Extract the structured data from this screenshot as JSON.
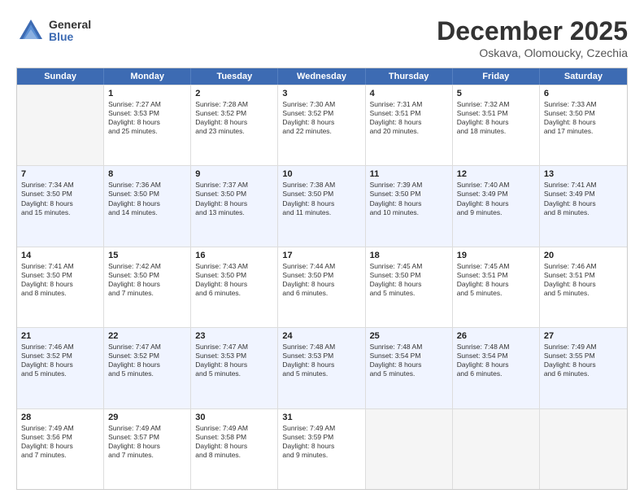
{
  "header": {
    "logo_line1": "General",
    "logo_line2": "Blue",
    "month": "December 2025",
    "location": "Oskava, Olomoucky, Czechia"
  },
  "days": [
    "Sunday",
    "Monday",
    "Tuesday",
    "Wednesday",
    "Thursday",
    "Friday",
    "Saturday"
  ],
  "rows": [
    [
      {
        "day": "",
        "lines": [],
        "empty": true
      },
      {
        "day": "1",
        "lines": [
          "Sunrise: 7:27 AM",
          "Sunset: 3:53 PM",
          "Daylight: 8 hours",
          "and 25 minutes."
        ]
      },
      {
        "day": "2",
        "lines": [
          "Sunrise: 7:28 AM",
          "Sunset: 3:52 PM",
          "Daylight: 8 hours",
          "and 23 minutes."
        ]
      },
      {
        "day": "3",
        "lines": [
          "Sunrise: 7:30 AM",
          "Sunset: 3:52 PM",
          "Daylight: 8 hours",
          "and 22 minutes."
        ]
      },
      {
        "day": "4",
        "lines": [
          "Sunrise: 7:31 AM",
          "Sunset: 3:51 PM",
          "Daylight: 8 hours",
          "and 20 minutes."
        ]
      },
      {
        "day": "5",
        "lines": [
          "Sunrise: 7:32 AM",
          "Sunset: 3:51 PM",
          "Daylight: 8 hours",
          "and 18 minutes."
        ]
      },
      {
        "day": "6",
        "lines": [
          "Sunrise: 7:33 AM",
          "Sunset: 3:50 PM",
          "Daylight: 8 hours",
          "and 17 minutes."
        ]
      }
    ],
    [
      {
        "day": "7",
        "lines": [
          "Sunrise: 7:34 AM",
          "Sunset: 3:50 PM",
          "Daylight: 8 hours",
          "and 15 minutes."
        ]
      },
      {
        "day": "8",
        "lines": [
          "Sunrise: 7:36 AM",
          "Sunset: 3:50 PM",
          "Daylight: 8 hours",
          "and 14 minutes."
        ]
      },
      {
        "day": "9",
        "lines": [
          "Sunrise: 7:37 AM",
          "Sunset: 3:50 PM",
          "Daylight: 8 hours",
          "and 13 minutes."
        ]
      },
      {
        "day": "10",
        "lines": [
          "Sunrise: 7:38 AM",
          "Sunset: 3:50 PM",
          "Daylight: 8 hours",
          "and 11 minutes."
        ]
      },
      {
        "day": "11",
        "lines": [
          "Sunrise: 7:39 AM",
          "Sunset: 3:50 PM",
          "Daylight: 8 hours",
          "and 10 minutes."
        ]
      },
      {
        "day": "12",
        "lines": [
          "Sunrise: 7:40 AM",
          "Sunset: 3:49 PM",
          "Daylight: 8 hours",
          "and 9 minutes."
        ]
      },
      {
        "day": "13",
        "lines": [
          "Sunrise: 7:41 AM",
          "Sunset: 3:49 PM",
          "Daylight: 8 hours",
          "and 8 minutes."
        ]
      }
    ],
    [
      {
        "day": "14",
        "lines": [
          "Sunrise: 7:41 AM",
          "Sunset: 3:50 PM",
          "Daylight: 8 hours",
          "and 8 minutes."
        ]
      },
      {
        "day": "15",
        "lines": [
          "Sunrise: 7:42 AM",
          "Sunset: 3:50 PM",
          "Daylight: 8 hours",
          "and 7 minutes."
        ]
      },
      {
        "day": "16",
        "lines": [
          "Sunrise: 7:43 AM",
          "Sunset: 3:50 PM",
          "Daylight: 8 hours",
          "and 6 minutes."
        ]
      },
      {
        "day": "17",
        "lines": [
          "Sunrise: 7:44 AM",
          "Sunset: 3:50 PM",
          "Daylight: 8 hours",
          "and 6 minutes."
        ]
      },
      {
        "day": "18",
        "lines": [
          "Sunrise: 7:45 AM",
          "Sunset: 3:50 PM",
          "Daylight: 8 hours",
          "and 5 minutes."
        ]
      },
      {
        "day": "19",
        "lines": [
          "Sunrise: 7:45 AM",
          "Sunset: 3:51 PM",
          "Daylight: 8 hours",
          "and 5 minutes."
        ]
      },
      {
        "day": "20",
        "lines": [
          "Sunrise: 7:46 AM",
          "Sunset: 3:51 PM",
          "Daylight: 8 hours",
          "and 5 minutes."
        ]
      }
    ],
    [
      {
        "day": "21",
        "lines": [
          "Sunrise: 7:46 AM",
          "Sunset: 3:52 PM",
          "Daylight: 8 hours",
          "and 5 minutes."
        ]
      },
      {
        "day": "22",
        "lines": [
          "Sunrise: 7:47 AM",
          "Sunset: 3:52 PM",
          "Daylight: 8 hours",
          "and 5 minutes."
        ]
      },
      {
        "day": "23",
        "lines": [
          "Sunrise: 7:47 AM",
          "Sunset: 3:53 PM",
          "Daylight: 8 hours",
          "and 5 minutes."
        ]
      },
      {
        "day": "24",
        "lines": [
          "Sunrise: 7:48 AM",
          "Sunset: 3:53 PM",
          "Daylight: 8 hours",
          "and 5 minutes."
        ]
      },
      {
        "day": "25",
        "lines": [
          "Sunrise: 7:48 AM",
          "Sunset: 3:54 PM",
          "Daylight: 8 hours",
          "and 5 minutes."
        ]
      },
      {
        "day": "26",
        "lines": [
          "Sunrise: 7:48 AM",
          "Sunset: 3:54 PM",
          "Daylight: 8 hours",
          "and 6 minutes."
        ]
      },
      {
        "day": "27",
        "lines": [
          "Sunrise: 7:49 AM",
          "Sunset: 3:55 PM",
          "Daylight: 8 hours",
          "and 6 minutes."
        ]
      }
    ],
    [
      {
        "day": "28",
        "lines": [
          "Sunrise: 7:49 AM",
          "Sunset: 3:56 PM",
          "Daylight: 8 hours",
          "and 7 minutes."
        ]
      },
      {
        "day": "29",
        "lines": [
          "Sunrise: 7:49 AM",
          "Sunset: 3:57 PM",
          "Daylight: 8 hours",
          "and 7 minutes."
        ]
      },
      {
        "day": "30",
        "lines": [
          "Sunrise: 7:49 AM",
          "Sunset: 3:58 PM",
          "Daylight: 8 hours",
          "and 8 minutes."
        ]
      },
      {
        "day": "31",
        "lines": [
          "Sunrise: 7:49 AM",
          "Sunset: 3:59 PM",
          "Daylight: 8 hours",
          "and 9 minutes."
        ]
      },
      {
        "day": "",
        "lines": [],
        "empty": true
      },
      {
        "day": "",
        "lines": [],
        "empty": true
      },
      {
        "day": "",
        "lines": [],
        "empty": true
      }
    ]
  ]
}
